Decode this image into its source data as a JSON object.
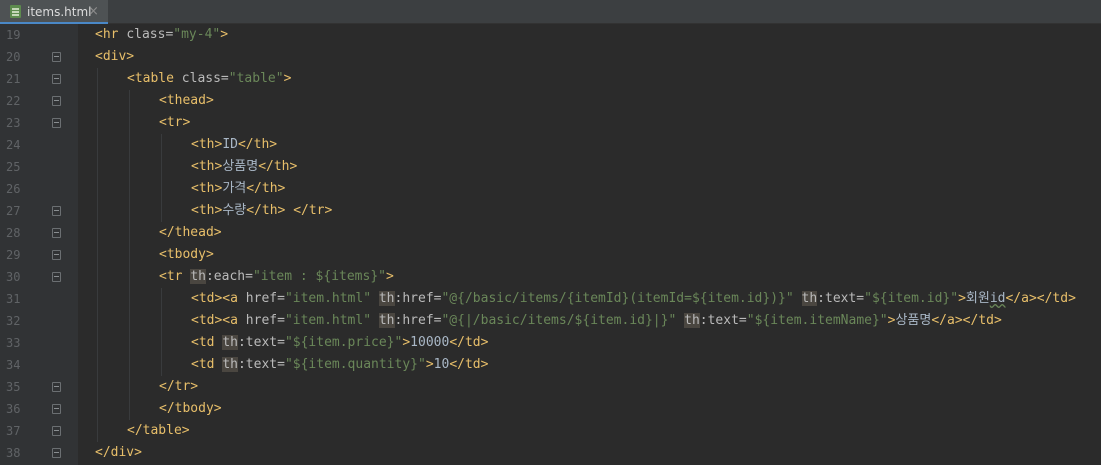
{
  "editor": {
    "tab_title": "items.html",
    "tab_close": "×"
  },
  "lines": [
    {
      "num": "19",
      "fold": "",
      "indent": 0,
      "tokens": [
        [
          "t",
          "<hr "
        ],
        [
          "a",
          "class="
        ],
        [
          "v",
          "\"my-4\""
        ],
        [
          "t",
          ">"
        ]
      ]
    },
    {
      "num": "20",
      "fold": "open",
      "indent": 0,
      "tokens": [
        [
          "t",
          "<div>"
        ]
      ]
    },
    {
      "num": "21",
      "fold": "open",
      "indent": 1,
      "tokens": [
        [
          "t",
          "<table "
        ],
        [
          "a",
          "class="
        ],
        [
          "v",
          "\"table\""
        ],
        [
          "t",
          ">"
        ]
      ]
    },
    {
      "num": "22",
      "fold": "open",
      "indent": 2,
      "tokens": [
        [
          "t",
          "<thead>"
        ]
      ]
    },
    {
      "num": "23",
      "fold": "open",
      "indent": 2,
      "tokens": [
        [
          "t",
          "<tr>"
        ]
      ]
    },
    {
      "num": "24",
      "fold": "",
      "indent": 3,
      "tokens": [
        [
          "t",
          "<th>"
        ],
        [
          "txt",
          "ID"
        ],
        [
          "t",
          "</th>"
        ]
      ]
    },
    {
      "num": "25",
      "fold": "",
      "indent": 3,
      "tokens": [
        [
          "t",
          "<th>"
        ],
        [
          "txt",
          "상품명"
        ],
        [
          "t",
          "</th>"
        ]
      ]
    },
    {
      "num": "26",
      "fold": "",
      "indent": 3,
      "tokens": [
        [
          "t",
          "<th>"
        ],
        [
          "txt",
          "가격"
        ],
        [
          "t",
          "</th>"
        ]
      ]
    },
    {
      "num": "27",
      "fold": "close-fold",
      "indent": 3,
      "tokens": [
        [
          "t",
          "<th>"
        ],
        [
          "txt",
          "수량"
        ],
        [
          "t",
          "</th>"
        ],
        [
          "txt",
          " "
        ],
        [
          "t",
          "</tr>"
        ]
      ]
    },
    {
      "num": "28",
      "fold": "close-fold",
      "indent": 2,
      "tokens": [
        [
          "t",
          "</thead>"
        ]
      ]
    },
    {
      "num": "29",
      "fold": "open",
      "indent": 2,
      "tokens": [
        [
          "t",
          "<tbody>"
        ]
      ]
    },
    {
      "num": "30",
      "fold": "open",
      "indent": 2,
      "tokens": [
        [
          "t",
          "<tr "
        ],
        [
          "th-attr",
          "th"
        ],
        [
          "a",
          ":each="
        ],
        [
          "v",
          "\"item : ${items}\""
        ],
        [
          "t",
          ">"
        ]
      ]
    },
    {
      "num": "31",
      "fold": "",
      "indent": 3,
      "tokens": [
        [
          "t",
          "<td><a "
        ],
        [
          "a",
          "href="
        ],
        [
          "v",
          "\"item.html\" "
        ],
        [
          "th-attr",
          "th"
        ],
        [
          "a",
          ":href="
        ],
        [
          "v",
          "\"@{/basic/items/{itemId}(itemId=${item.id})}\" "
        ],
        [
          "th-attr",
          "th"
        ],
        [
          "a",
          ":text="
        ],
        [
          "v",
          "\"${item.id}\""
        ],
        [
          "t",
          ">"
        ],
        [
          "txt",
          "회원"
        ],
        [
          "wavy",
          "id"
        ],
        [
          "t",
          "</a></td>"
        ]
      ]
    },
    {
      "num": "32",
      "fold": "",
      "indent": 3,
      "tokens": [
        [
          "t",
          "<td><a "
        ],
        [
          "a",
          "href="
        ],
        [
          "v",
          "\"item.html\" "
        ],
        [
          "th-attr",
          "th"
        ],
        [
          "a",
          ":href="
        ],
        [
          "v",
          "\"@{|/basic/items/${item.id}|}\" "
        ],
        [
          "th-attr",
          "th"
        ],
        [
          "a",
          ":text="
        ],
        [
          "v",
          "\"${item.itemName}\""
        ],
        [
          "t",
          ">"
        ],
        [
          "txt",
          "상품명"
        ],
        [
          "t",
          "</a></td>"
        ]
      ]
    },
    {
      "num": "33",
      "fold": "",
      "indent": 3,
      "tokens": [
        [
          "t",
          "<td "
        ],
        [
          "th-attr",
          "th"
        ],
        [
          "a",
          ":text="
        ],
        [
          "v",
          "\"${item.price}\""
        ],
        [
          "t",
          ">"
        ],
        [
          "txt",
          "10000"
        ],
        [
          "t",
          "</td>"
        ]
      ]
    },
    {
      "num": "34",
      "fold": "",
      "indent": 3,
      "tokens": [
        [
          "t",
          "<td "
        ],
        [
          "th-attr",
          "th"
        ],
        [
          "a",
          ":text="
        ],
        [
          "v",
          "\"${item.quantity}\""
        ],
        [
          "t",
          ">"
        ],
        [
          "txt",
          "10"
        ],
        [
          "t",
          "</td>"
        ]
      ]
    },
    {
      "num": "35",
      "fold": "close-fold",
      "indent": 2,
      "tokens": [
        [
          "t",
          "</tr>"
        ]
      ]
    },
    {
      "num": "36",
      "fold": "close-fold",
      "indent": 2,
      "tokens": [
        [
          "t",
          "</tbody>"
        ]
      ]
    },
    {
      "num": "37",
      "fold": "close-fold",
      "indent": 1,
      "tokens": [
        [
          "t",
          "</table>"
        ]
      ]
    },
    {
      "num": "38",
      "fold": "close-fold",
      "indent": 0,
      "tokens": [
        [
          "t",
          "</div>"
        ]
      ]
    }
  ]
}
